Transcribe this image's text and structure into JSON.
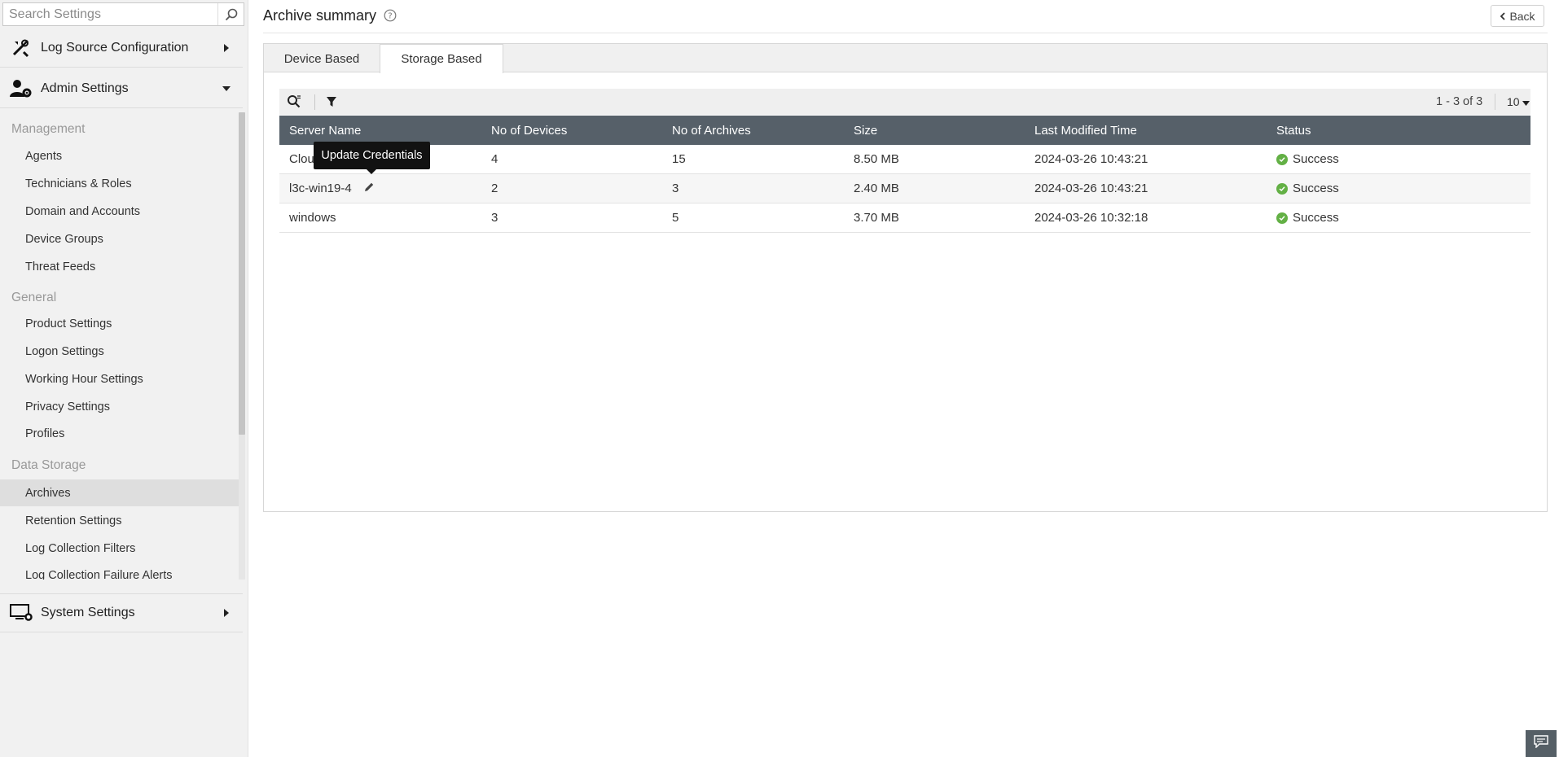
{
  "sidebar": {
    "search": {
      "placeholder": "Search Settings"
    },
    "sections": {
      "log_source": {
        "label": "Log Source Configuration"
      },
      "admin": {
        "label": "Admin Settings"
      },
      "system": {
        "label": "System Settings"
      }
    },
    "groups": [
      {
        "title": "Management",
        "items": [
          "Agents",
          "Technicians & Roles",
          "Domain and Accounts",
          "Device Groups",
          "Threat Feeds"
        ]
      },
      {
        "title": "General",
        "items": [
          "Product Settings",
          "Logon Settings",
          "Working Hour Settings",
          "Privacy Settings",
          "Profiles"
        ]
      },
      {
        "title": "Data Storage",
        "items": [
          "Archives",
          "Retention Settings",
          "Log Collection Filters",
          "Log Collection Failure Alerts"
        ]
      }
    ],
    "active_item": "Archives"
  },
  "header": {
    "title": "Archive summary",
    "back_label": "Back"
  },
  "tabs": [
    {
      "label": "Device Based",
      "active": false
    },
    {
      "label": "Storage Based",
      "active": true
    }
  ],
  "toolbar": {
    "pager": "1 - 3 of 3",
    "page_size": "10"
  },
  "table": {
    "columns": [
      "Server Name",
      "No of Devices",
      "No of Archives",
      "Size",
      "Last Modified Time",
      "Status"
    ],
    "rows": [
      {
        "server": "Clou",
        "devices": "4",
        "archives": "15",
        "size": "8.50 MB",
        "modified": "2024-03-26 10:43:21",
        "status": "Success"
      },
      {
        "server": "l3c-win19-4",
        "devices": "2",
        "archives": "3",
        "size": "2.40 MB",
        "modified": "2024-03-26 10:43:21",
        "status": "Success"
      },
      {
        "server": "windows",
        "devices": "3",
        "archives": "5",
        "size": "3.70 MB",
        "modified": "2024-03-26 10:32:18",
        "status": "Success"
      }
    ]
  },
  "tooltip": {
    "text": "Update Credentials"
  },
  "colors": {
    "header_bg": "#566069",
    "success": "#63b045",
    "sidebar_bg": "#f1f1f1"
  },
  "icons": {
    "search": "search-icon",
    "log_source": "tools-icon",
    "admin": "user-gear-icon",
    "system": "monitor-gear-icon",
    "help": "help-icon",
    "back": "chevron-left-icon",
    "grid_search": "table-search-icon",
    "filter": "filter-icon",
    "edit": "pencil-icon",
    "status": "check-circle-icon",
    "chat": "chat-icon"
  }
}
